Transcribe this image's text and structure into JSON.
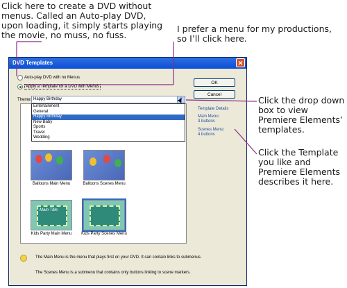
{
  "callouts": {
    "top_left": "Click here to create a DVD without menus. Called an Auto-play DVD, upon loading, it simply starts playing the movie, no muss, no fuss.",
    "top_right": "I prefer a menu for my productions, so I’ll click here.",
    "right_1": "Click the drop down box to view Premiere Elements’ templates.",
    "right_2": "Click the Template you like and Premiere Elements describes it here."
  },
  "dialog": {
    "title": "DVD Templates",
    "close_glyph": "✕",
    "radio_autoplay": "Auto-play DVD with no Menus",
    "radio_template": "Apply a Template for a DVD with Menus",
    "ok_label": "OK",
    "cancel_label": "Cancel",
    "theme_label": "Theme:",
    "theme_value": "Happy Birthday",
    "dropdown_arrow": "▼",
    "theme_options": [
      "Entertainment",
      "General",
      "Happy Birthday",
      "New Baby",
      "Sports",
      "Travel",
      "Wedding"
    ],
    "selected_option": "Happy Birthday",
    "templates": [
      {
        "caption": "Balloons Main Menu"
      },
      {
        "caption": "Balloons Scenes Menu"
      },
      {
        "caption": "Kids Party Main Menu"
      },
      {
        "caption": "Kids Party Scenes Menu"
      }
    ],
    "kids_thumb_title": "Main Title",
    "details": {
      "heading": "Template Details",
      "main_menu_label": "Main Menu:",
      "main_menu_value": "3 buttons",
      "scenes_menu_label": "Scenes Menu:",
      "scenes_menu_value": "4 buttons"
    },
    "info": {
      "main_menu_text": "The Main Menu is the menu that plays first on your DVD. It can contain links to submenus.",
      "scenes_menu_text": "The Scenes Menu is a submenu that contains only buttons linking to scene markers."
    }
  },
  "colors": {
    "titlebar": "#0a4fd6",
    "selection": "#316ac5",
    "leader_line": "#8b2a8b"
  }
}
